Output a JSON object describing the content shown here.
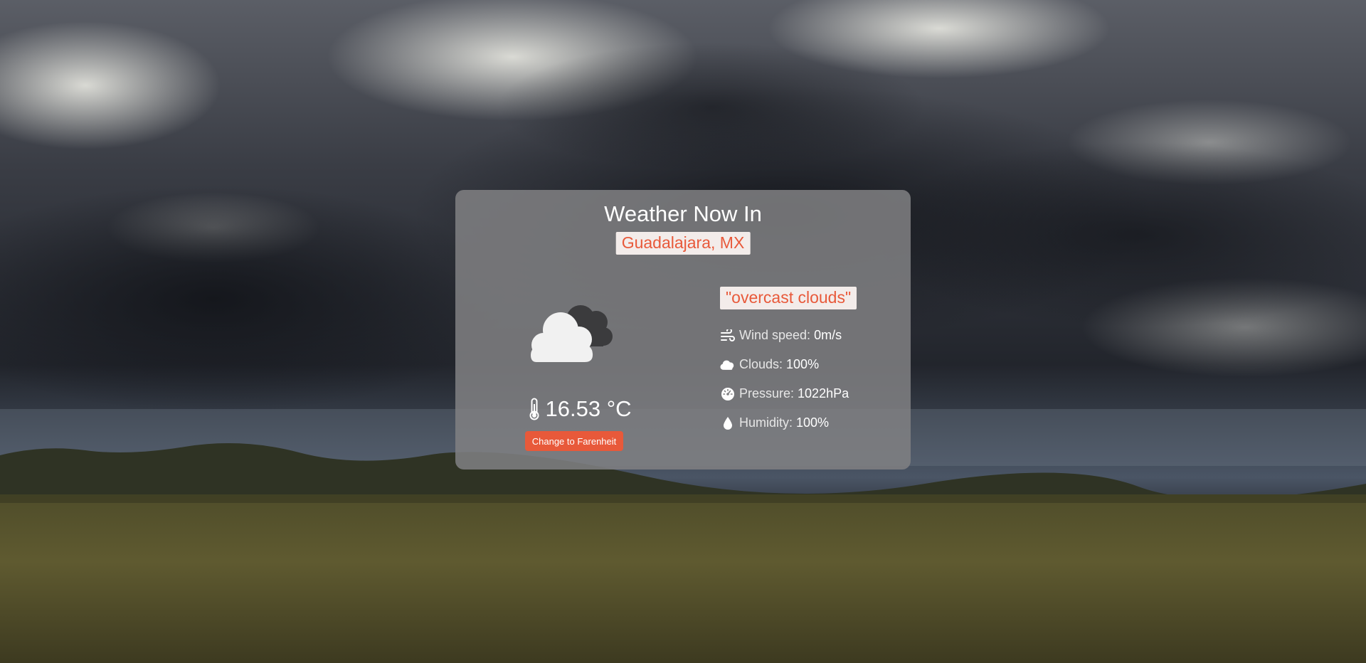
{
  "card": {
    "title": "Weather Now In",
    "location": "Guadalajara, MX"
  },
  "current": {
    "icon": "overcast-clouds-icon",
    "temperature": "16.53 °C",
    "toggle_label": "Change to Farenheit",
    "description": "\"overcast clouds\""
  },
  "stats": [
    {
      "icon": "wind-icon",
      "label": "Wind speed:",
      "value": "0m/s"
    },
    {
      "icon": "cloud-icon",
      "label": "Clouds:",
      "value": "100%"
    },
    {
      "icon": "gauge-icon",
      "label": "Pressure:",
      "value": "1022hPa"
    },
    {
      "icon": "droplet-icon",
      "label": "Humidity:",
      "value": "100%"
    }
  ],
  "colors": {
    "accent": "#e8593a",
    "label_background": "#f3ecea",
    "card_background": "#808082"
  }
}
